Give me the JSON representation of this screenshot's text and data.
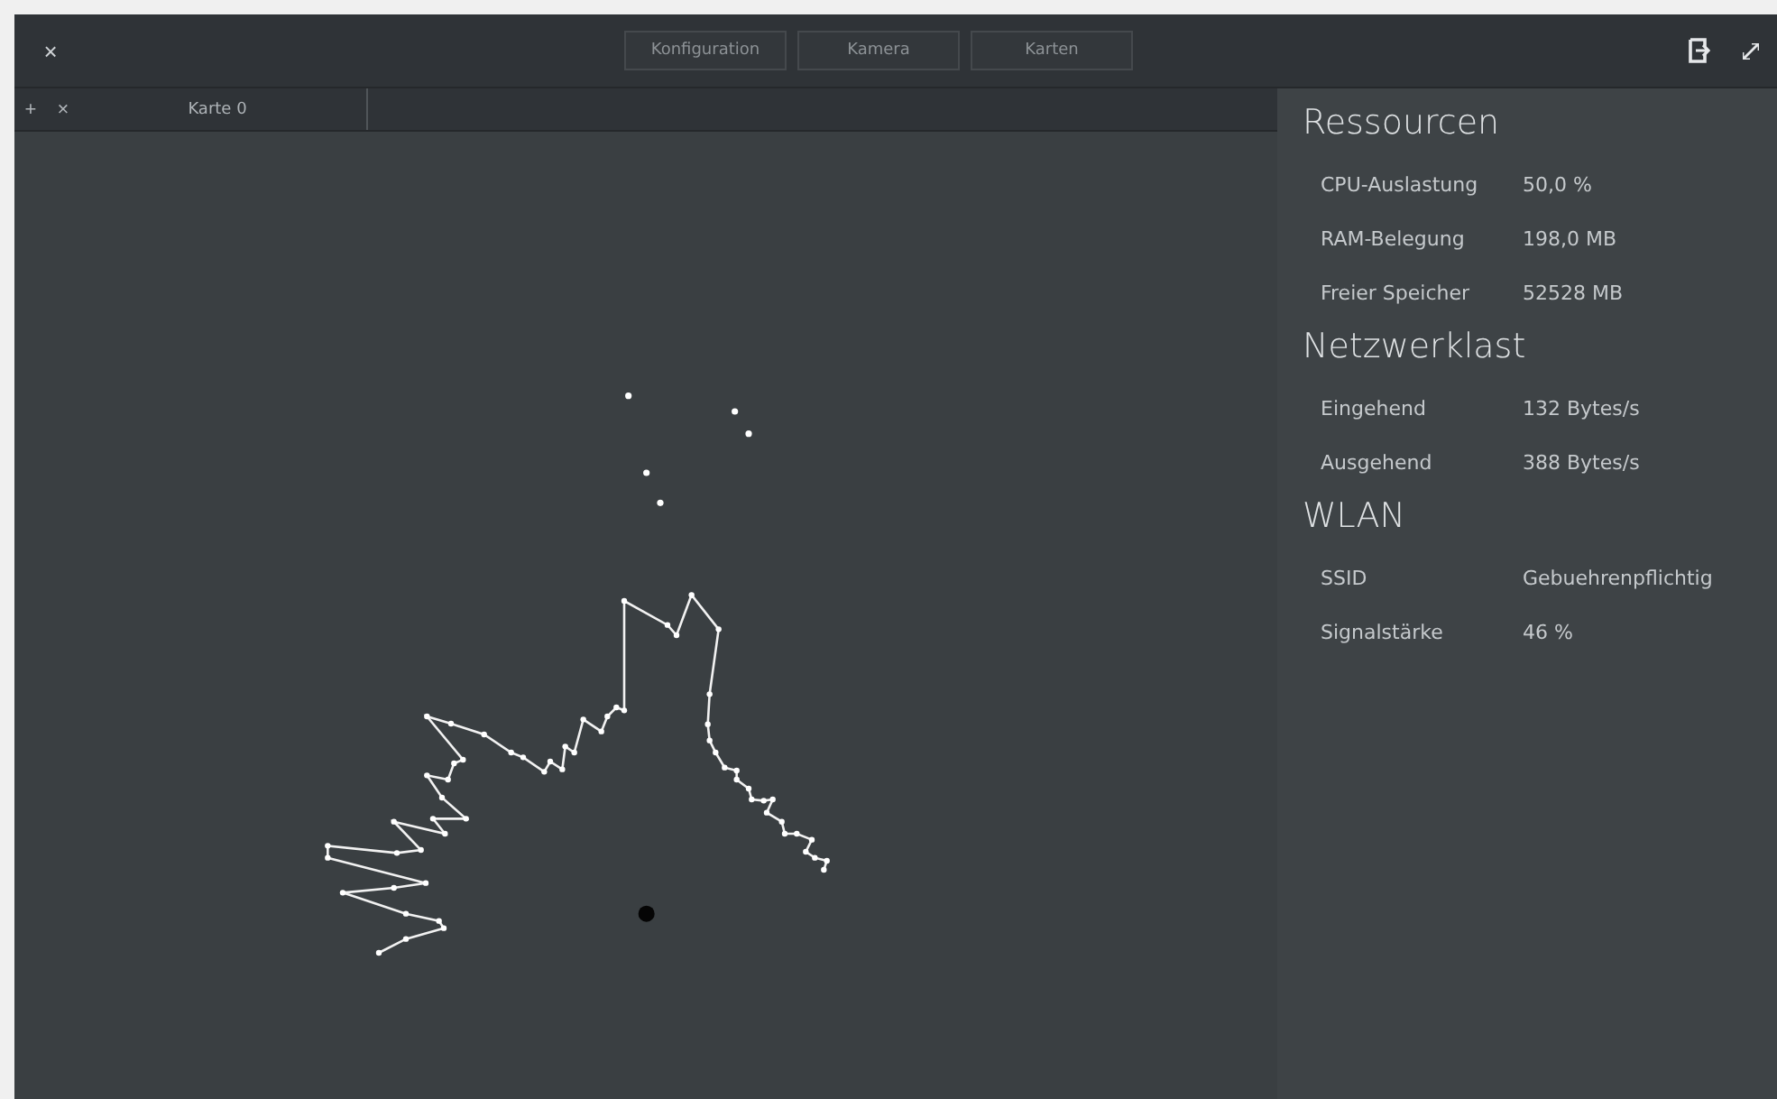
{
  "window": {
    "close": "×"
  },
  "tabs": [
    {
      "label": "Konfiguration"
    },
    {
      "label": "Kamera"
    },
    {
      "label": "Karten"
    }
  ],
  "map_tabs": {
    "add": "+",
    "close": "×",
    "items": [
      {
        "label": "Karte 0"
      }
    ]
  },
  "sections": [
    {
      "title": "Ressourcen",
      "rows": [
        {
          "label": "CPU-Auslastung",
          "value": "50,0 %"
        },
        {
          "label": "RAM-Belegung",
          "value": "198,0 MB"
        },
        {
          "label": "Freier Speicher",
          "value": "52528 MB"
        }
      ]
    },
    {
      "title": "Netzwerklast",
      "rows": [
        {
          "label": "Eingehend",
          "value": "132 Bytes/s"
        },
        {
          "label": "Ausgehend",
          "value": "388 Bytes/s"
        }
      ]
    },
    {
      "title": "WLAN",
      "rows": [
        {
          "label": "SSID",
          "value": "Gebuehrenpflichtig"
        },
        {
          "label": "Signalstärke",
          "value": "46 %"
        }
      ]
    }
  ]
}
